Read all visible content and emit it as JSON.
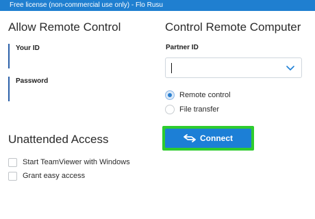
{
  "license_bar": {
    "text": "Free license (non-commercial use only) - Flo Rusu"
  },
  "allow_remote": {
    "title": "Allow Remote Control",
    "your_id_label": "Your ID",
    "password_label": "Password"
  },
  "control_remote": {
    "title": "Control Remote Computer",
    "partner_id_label": "Partner ID",
    "partner_id_value": "",
    "options": [
      {
        "label": "Remote control",
        "selected": true
      },
      {
        "label": "File transfer",
        "selected": false
      }
    ],
    "connect_label": "Connect",
    "connect_icon": "swap-arrows-icon"
  },
  "unattended": {
    "title": "Unattended Access",
    "items": [
      {
        "label": "Start TeamViewer with Windows",
        "checked": false
      },
      {
        "label": "Grant easy access",
        "checked": false
      }
    ]
  },
  "colors": {
    "accent": "#1c7fd6",
    "license_bar": "#1f7fd0",
    "highlight": "#2ecc2e",
    "id_marker": "#2a5fa8"
  }
}
